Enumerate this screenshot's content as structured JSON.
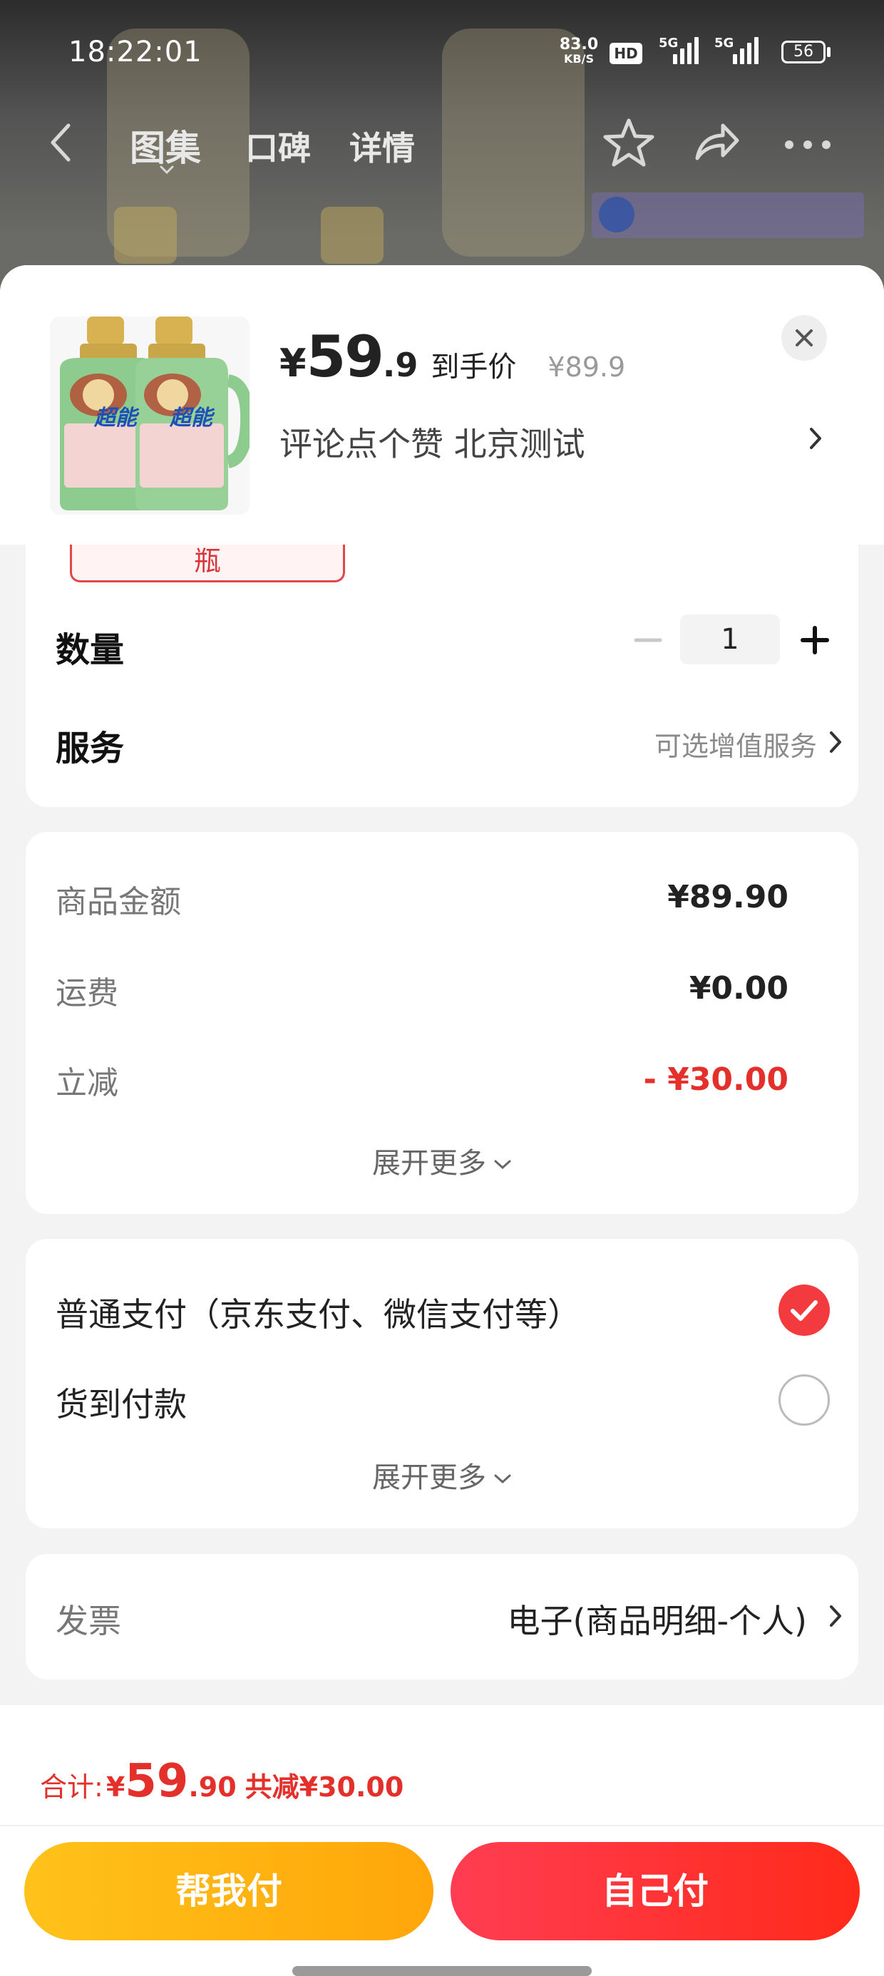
{
  "status_bar": {
    "time": "18:22:01",
    "net_speed_value": "83.0",
    "net_speed_unit": "KB/S",
    "hd_badge": "HD",
    "signal_1": "5G",
    "signal_2": "5G",
    "battery": "56"
  },
  "nav": {
    "tabs": [
      {
        "label": "图集",
        "active": true
      },
      {
        "label": "口碑",
        "active": false
      },
      {
        "label": "详情",
        "active": false
      }
    ],
    "icons": [
      "back-icon",
      "star-icon",
      "share-icon",
      "more-icon"
    ]
  },
  "header": {
    "price_symbol": "¥",
    "price_integer": "59",
    "price_decimal": ".9",
    "price_label": "到手价",
    "original_price": "¥89.9",
    "sku_description": "评论点个赞  北京测试",
    "product_brand": "超能"
  },
  "spec": {
    "selected_tag": "瓶"
  },
  "quantity": {
    "label": "数量",
    "value": "1",
    "minus": "−",
    "plus": "+"
  },
  "service": {
    "label": "服务",
    "value": "可选增值服务"
  },
  "amounts": {
    "rows": [
      {
        "label": "商品金额",
        "value": "¥89.90",
        "highlight": false
      },
      {
        "label": "运费",
        "value": "¥0.00",
        "highlight": false
      },
      {
        "label": "立减",
        "value": "- ¥30.00",
        "highlight": true
      }
    ],
    "expand": "展开更多"
  },
  "payment": {
    "options": [
      {
        "label": "普通支付（京东支付、微信支付等）",
        "selected": true
      },
      {
        "label": "货到付款",
        "selected": false
      }
    ],
    "expand": "展开更多"
  },
  "invoice": {
    "label": "发票",
    "value": "电子(商品明细-个人)"
  },
  "footer": {
    "total_label": "合计:",
    "total_symbol": "¥",
    "total_integer": "59",
    "total_decimal": ".90",
    "total_saved": "共减¥30.00",
    "pay_for_me": "帮我付",
    "pay_self": "自己付"
  },
  "colors": {
    "accent_red": "#e4302b",
    "check_red": "#f23a3f",
    "yellow_button": "#ffb20f",
    "red_button": "#ff3336"
  }
}
